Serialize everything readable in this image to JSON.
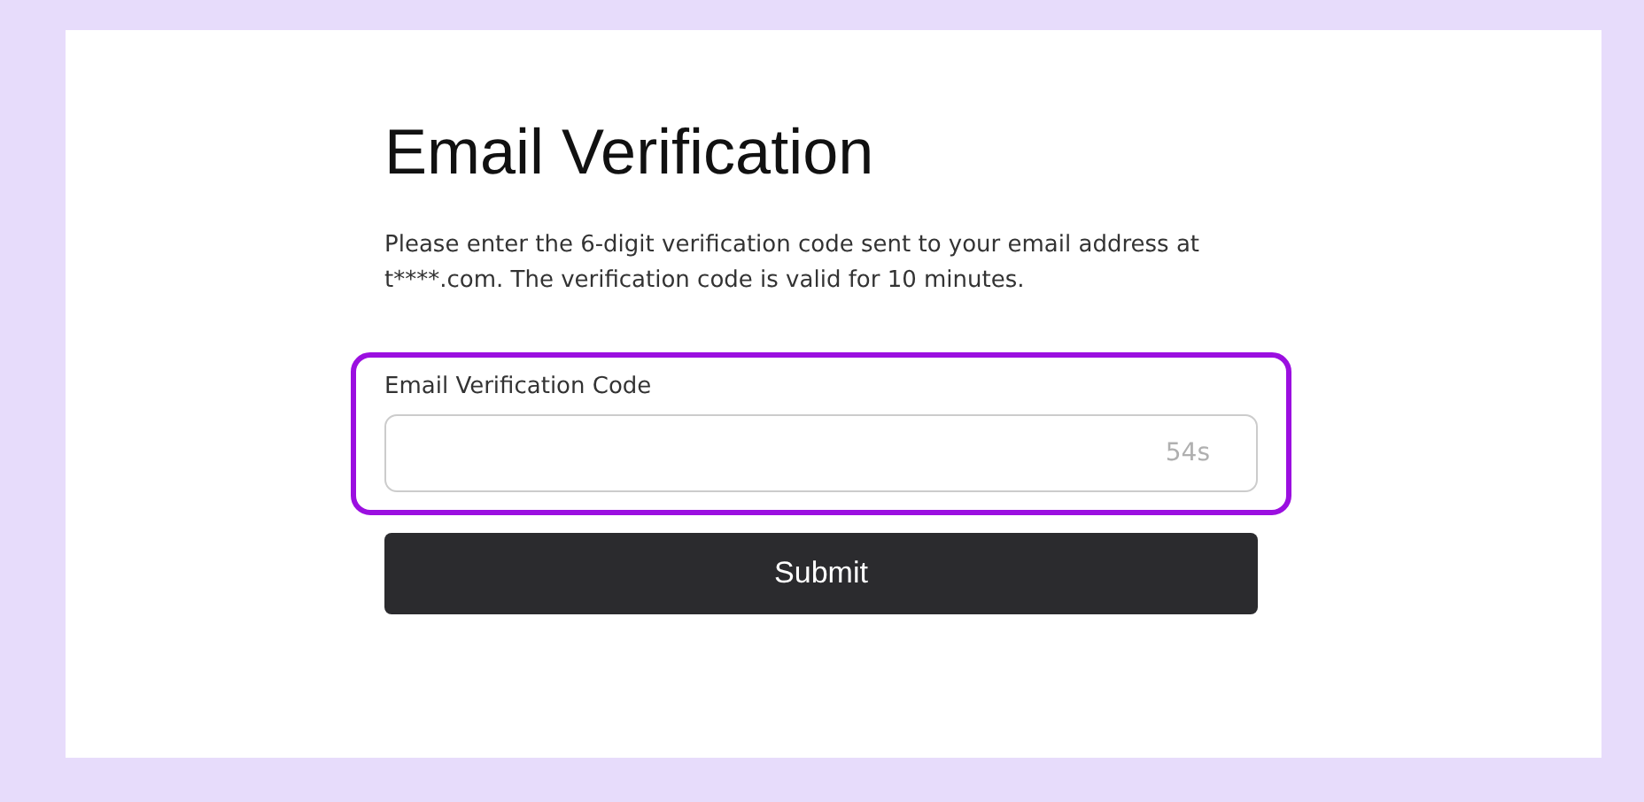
{
  "title": "Email Verification",
  "description": "Please enter the 6-digit verification code sent to your email address at t****.com. The verification code is valid for 10 minutes.",
  "field": {
    "label": "Email Verification Code",
    "countdown": "54s",
    "highlighted": true
  },
  "submit_button": {
    "label": "Submit"
  }
}
